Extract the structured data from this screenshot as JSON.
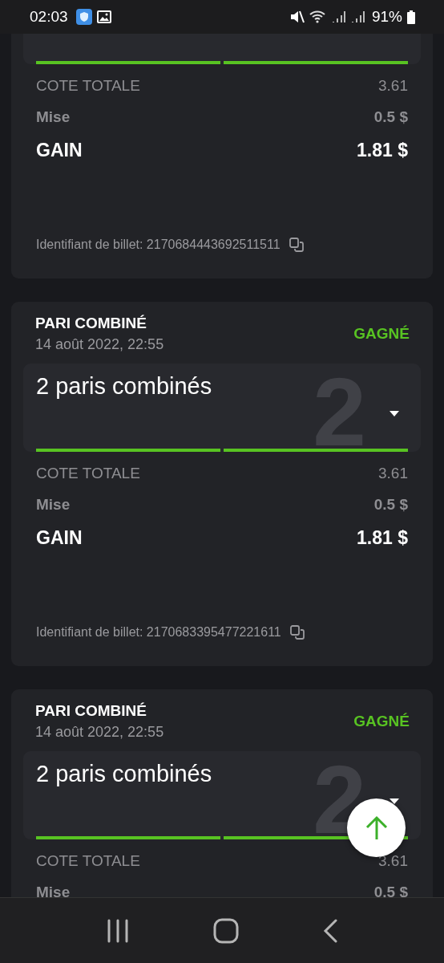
{
  "status_bar": {
    "time": "02:03",
    "battery": "91%"
  },
  "bets": [
    {
      "legs": [
        {
          "won": true
        },
        {
          "won": true
        }
      ],
      "total_odds_label": "COTE TOTALE",
      "total_odds": "3.61",
      "stake_label": "Mise",
      "stake": "0.5 $",
      "gain_label": "GAIN",
      "gain": "1.81 $",
      "ticket": "Identifiant de billet: 2170684443692511511"
    },
    {
      "title": "PARI COMBINÉ",
      "date": "14 août 2022, 22:55",
      "status": "GAGNÉ",
      "won": true,
      "legs_label": "2 paris combinés",
      "count": "2",
      "expanded": false,
      "legs": [
        {
          "won": true
        },
        {
          "won": true
        }
      ],
      "total_odds_label": "COTE TOTALE",
      "total_odds": "3.61",
      "stake_label": "Mise",
      "stake": "0.5 $",
      "gain_label": "GAIN",
      "gain": "1.81 $",
      "ticket": "Identifiant de billet: 2170683395477221611"
    },
    {
      "title": "PARI COMBINÉ",
      "date": "14 août 2022, 22:55",
      "status": "GAGNÉ",
      "won": true,
      "legs_label": "2 paris combinés",
      "count": "2",
      "expanded": false,
      "legs": [
        {
          "won": true
        },
        {
          "won": true
        }
      ],
      "total_odds_label": "COTE TOTALE",
      "total_odds": "3.61",
      "stake_label": "Mise",
      "stake": "0.5 $"
    }
  ]
}
